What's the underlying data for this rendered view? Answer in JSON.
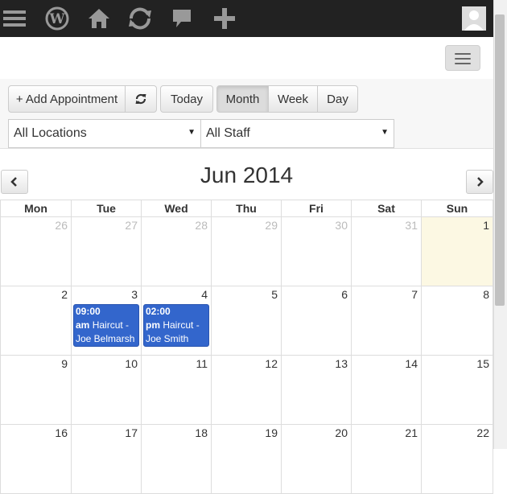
{
  "adminbar": {
    "icons": [
      "menu-icon",
      "wordpress-icon",
      "home-icon",
      "refresh-icon",
      "comment-icon",
      "plus-icon",
      "user-avatar-icon"
    ]
  },
  "toolbar": {
    "add_label": "+ Add Appointment",
    "today_label": "Today",
    "month_label": "Month",
    "week_label": "Week",
    "day_label": "Day",
    "active_view": "Month",
    "location_select": "All Locations",
    "staff_select": "All Staff"
  },
  "calendar": {
    "title": "Jun 2014",
    "weekdays": [
      "Mon",
      "Tue",
      "Wed",
      "Thu",
      "Fri",
      "Sat",
      "Sun"
    ],
    "weeks": [
      [
        {
          "d": "26",
          "other": true
        },
        {
          "d": "27",
          "other": true
        },
        {
          "d": "28",
          "other": true
        },
        {
          "d": "29",
          "other": true
        },
        {
          "d": "30",
          "other": true
        },
        {
          "d": "31",
          "other": true
        },
        {
          "d": "1",
          "today": true
        }
      ],
      [
        {
          "d": "2"
        },
        {
          "d": "3",
          "event": {
            "time1": "09:00",
            "time2": "am",
            "text": "Haircut - Joe Belmarsh"
          }
        },
        {
          "d": "4",
          "event": {
            "time1": "02:00",
            "time2": "pm",
            "text": "Haircut - Joe Smith"
          }
        },
        {
          "d": "5"
        },
        {
          "d": "6"
        },
        {
          "d": "7"
        },
        {
          "d": "8"
        }
      ],
      [
        {
          "d": "9"
        },
        {
          "d": "10"
        },
        {
          "d": "11"
        },
        {
          "d": "12"
        },
        {
          "d": "13"
        },
        {
          "d": "14"
        },
        {
          "d": "15"
        }
      ],
      [
        {
          "d": "16"
        },
        {
          "d": "17"
        },
        {
          "d": "18"
        },
        {
          "d": "19"
        },
        {
          "d": "20"
        },
        {
          "d": "21"
        },
        {
          "d": "22"
        }
      ]
    ]
  },
  "colors": {
    "event": "#3366cc",
    "today": "#fcf8e3",
    "adminbar": "#222222"
  }
}
